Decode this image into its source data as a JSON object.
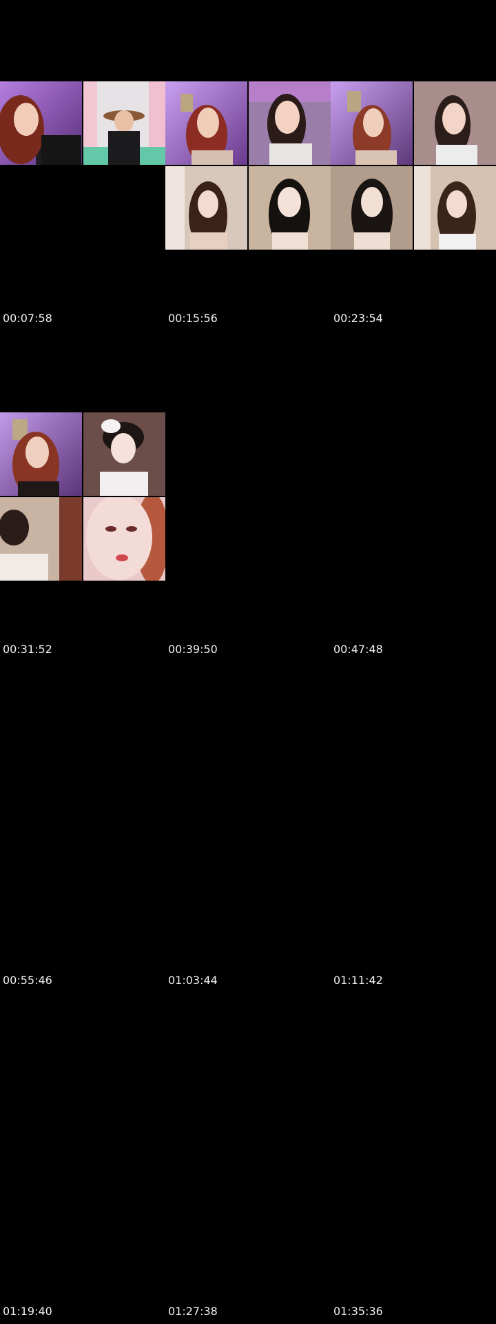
{
  "contact_sheet": {
    "background": "#000000",
    "text_color": "#f2f2f2",
    "thumbnails": [
      {
        "timestamp": "00:07:58"
      },
      {
        "timestamp": "00:15:56"
      },
      {
        "timestamp": "00:23:54"
      },
      {
        "timestamp": "00:31:52"
      },
      {
        "timestamp": "00:39:50"
      },
      {
        "timestamp": "00:47:48"
      },
      {
        "timestamp": "00:55:46"
      },
      {
        "timestamp": "01:03:44"
      },
      {
        "timestamp": "01:11:42"
      },
      {
        "timestamp": "01:19:40"
      },
      {
        "timestamp": "01:27:38"
      },
      {
        "timestamp": "01:35:36"
      }
    ]
  }
}
